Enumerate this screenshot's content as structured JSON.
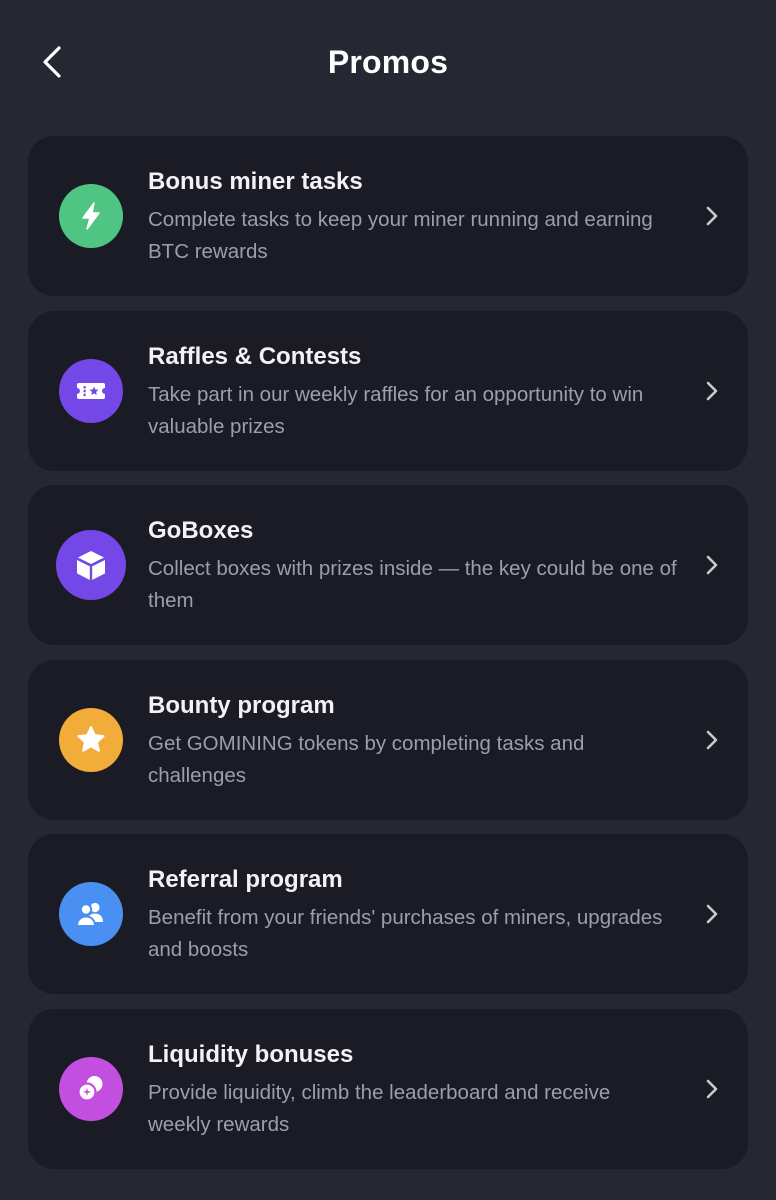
{
  "header": {
    "title": "Promos",
    "back_icon": "chevron-left-icon"
  },
  "promos": [
    {
      "title": "Bonus miner tasks",
      "description": "Complete tasks to keep your miner running and earning BTC rewards",
      "icon": "lightning-icon",
      "color": "#4fc483"
    },
    {
      "title": "Raffles & Contests",
      "description": "Take part in our weekly raffles for an opportunity to win valuable prizes",
      "icon": "ticket-icon",
      "color": "#7448e6"
    },
    {
      "title": "GoBoxes",
      "description": "Collect boxes with prizes inside — the key could be one of them",
      "icon": "box-icon",
      "color": "#7448e6"
    },
    {
      "title": "Bounty program",
      "description": "Get GOMINING tokens by completing tasks and challenges",
      "icon": "star-icon",
      "color": "#f2ac3a"
    },
    {
      "title": "Referral program",
      "description": "Benefit from your friends' purchases of miners, upgrades and boosts",
      "icon": "users-icon",
      "color": "#4a8ff2"
    },
    {
      "title": "Liquidity bonuses",
      "description": "Provide liquidity, climb the leaderboard and receive weekly rewards",
      "icon": "coins-icon",
      "color": "#c24fe0"
    }
  ]
}
